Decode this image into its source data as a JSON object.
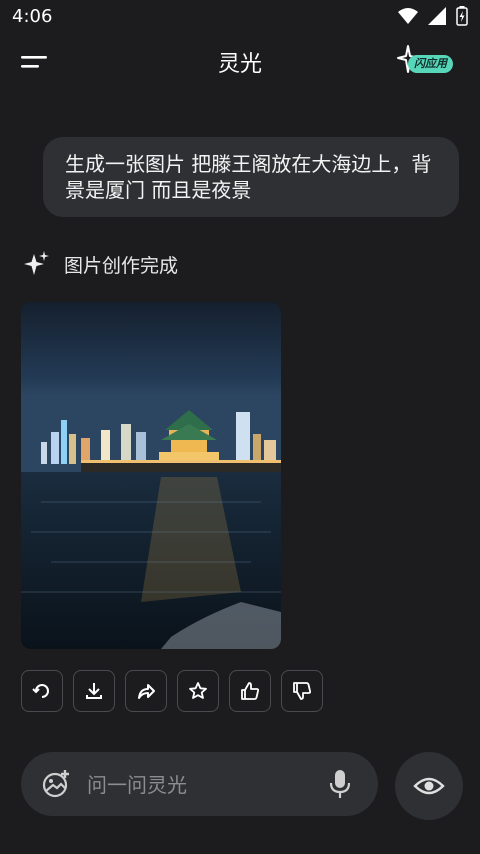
{
  "status_bar": {
    "time": "4:06"
  },
  "header": {
    "title": "灵光",
    "flash_app_label": "闪应用"
  },
  "conversation": {
    "user_message": "生成一张图片 把滕王阁放在大海边上，背景是厦门 而且是夜景",
    "result_status": "图片创作完成"
  },
  "actions": [
    "regenerate-icon",
    "download-icon",
    "share-icon",
    "favorite-icon",
    "like-icon",
    "dislike-icon"
  ],
  "input": {
    "placeholder": "问一问灵光"
  }
}
